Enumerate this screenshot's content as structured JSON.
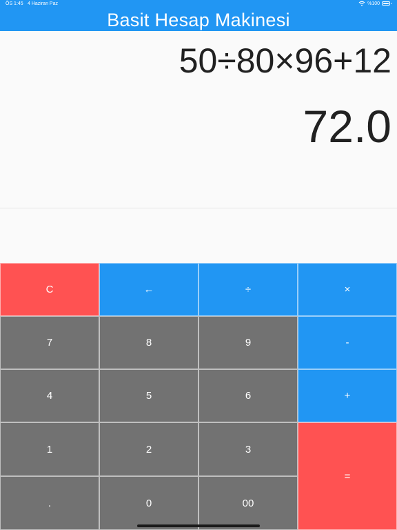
{
  "status_bar": {
    "time": "ÖS 1:45",
    "date": "4 Haziran Paz",
    "battery": "%100",
    "icons": [
      "wifi-icon",
      "battery-icon"
    ]
  },
  "app_bar": {
    "title": "Basit Hesap Makinesi",
    "color": "#2196f3"
  },
  "display": {
    "expression": "50÷80×96+12",
    "result": "72.0"
  },
  "keys": {
    "clear": "C",
    "backspace": "←",
    "divide": "÷",
    "multiply": "×",
    "seven": "7",
    "eight": "8",
    "nine": "9",
    "minus": "-",
    "four": "4",
    "five": "5",
    "six": "6",
    "plus": "+",
    "one": "1",
    "two": "2",
    "three": "3",
    "equals": "=",
    "dot": ".",
    "zero": "0",
    "double_zero": "00"
  },
  "colors": {
    "accent_blue": "#2196f3",
    "clear_red": "#ff5252",
    "digit_gray": "#727272"
  }
}
